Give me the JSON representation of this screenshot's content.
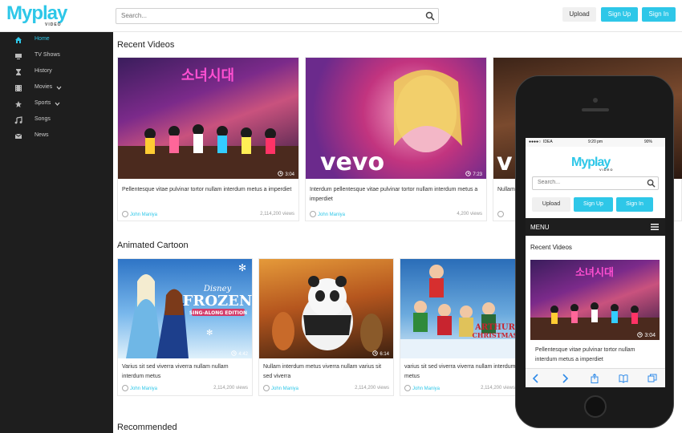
{
  "header": {
    "logo_text": "Myplay",
    "logo_sub": "VIDEO",
    "search_placeholder": "Search...",
    "upload_label": "Upload",
    "signup_label": "Sign Up",
    "signin_label": "Sign In"
  },
  "sidebar": {
    "items": [
      {
        "label": "Home",
        "icon": "home-icon",
        "active": true
      },
      {
        "label": "TV Shows",
        "icon": "tv-icon"
      },
      {
        "label": "History",
        "icon": "hourglass-icon"
      },
      {
        "label": "Movies",
        "icon": "film-icon",
        "has_submenu": true
      },
      {
        "label": "Sports",
        "icon": "trophy-icon",
        "has_submenu": true
      },
      {
        "label": "Songs",
        "icon": "music-icon"
      },
      {
        "label": "News",
        "icon": "newspaper-icon"
      }
    ]
  },
  "sections": {
    "recent": "Recent Videos",
    "cartoon": "Animated Cartoon",
    "recommended": "Recommended"
  },
  "recent_videos": [
    {
      "title": "Pellentesque vitae pulvinar tortor nullam interdum metus a imperdiet",
      "author": "John Maniya",
      "views": "2,114,200 views",
      "duration": "3:04"
    },
    {
      "title": "Interdum pellentesque vitae pulvinar tortor nullam interdum metus a imperdiet",
      "author": "John Maniya",
      "views": "4,200 views",
      "duration": "7:23",
      "overlay": "vevo"
    },
    {
      "title": "Nullam",
      "author": "John Maniya",
      "views": "",
      "duration": "",
      "overlay": "v"
    }
  ],
  "cartoon_videos": [
    {
      "title": "Varius sit sed viverra viverra nullam nullam interdum metus",
      "author": "John Maniya",
      "views": "2,114,200 views",
      "duration": "4:42",
      "overlay": "FROZEN",
      "brand": "Disney",
      "subtitle": "SING-ALONG EDITION"
    },
    {
      "title": "Nullam interdum metus viverra nullam varius sit sed viverra",
      "author": "John Maniya",
      "views": "2,114,200 views",
      "duration": "6:14"
    },
    {
      "title": "varius sit sed viverra viverra nullam interdum metus",
      "author": "John Maniya",
      "views": "2,114,200 views",
      "duration": "",
      "overlay": "ARTHUR CHRISTMAS"
    }
  ],
  "mobile": {
    "carrier": "IDEA",
    "time": "9:20 pm",
    "battery": "90%",
    "logo_text": "Myplay",
    "logo_sub": "VIDEO",
    "search_placeholder": "Search...",
    "upload_label": "Upload",
    "signup_label": "Sign Up",
    "signin_label": "Sign In",
    "menu_label": "MENU",
    "section": "Recent Videos",
    "video_title": "Pellentesque vitae pulvinar tortor nullam interdum metus a imperdiet",
    "duration": "3:04"
  },
  "colors": {
    "accent": "#2ec7e8",
    "sidebar_bg": "#1e1e1e"
  }
}
